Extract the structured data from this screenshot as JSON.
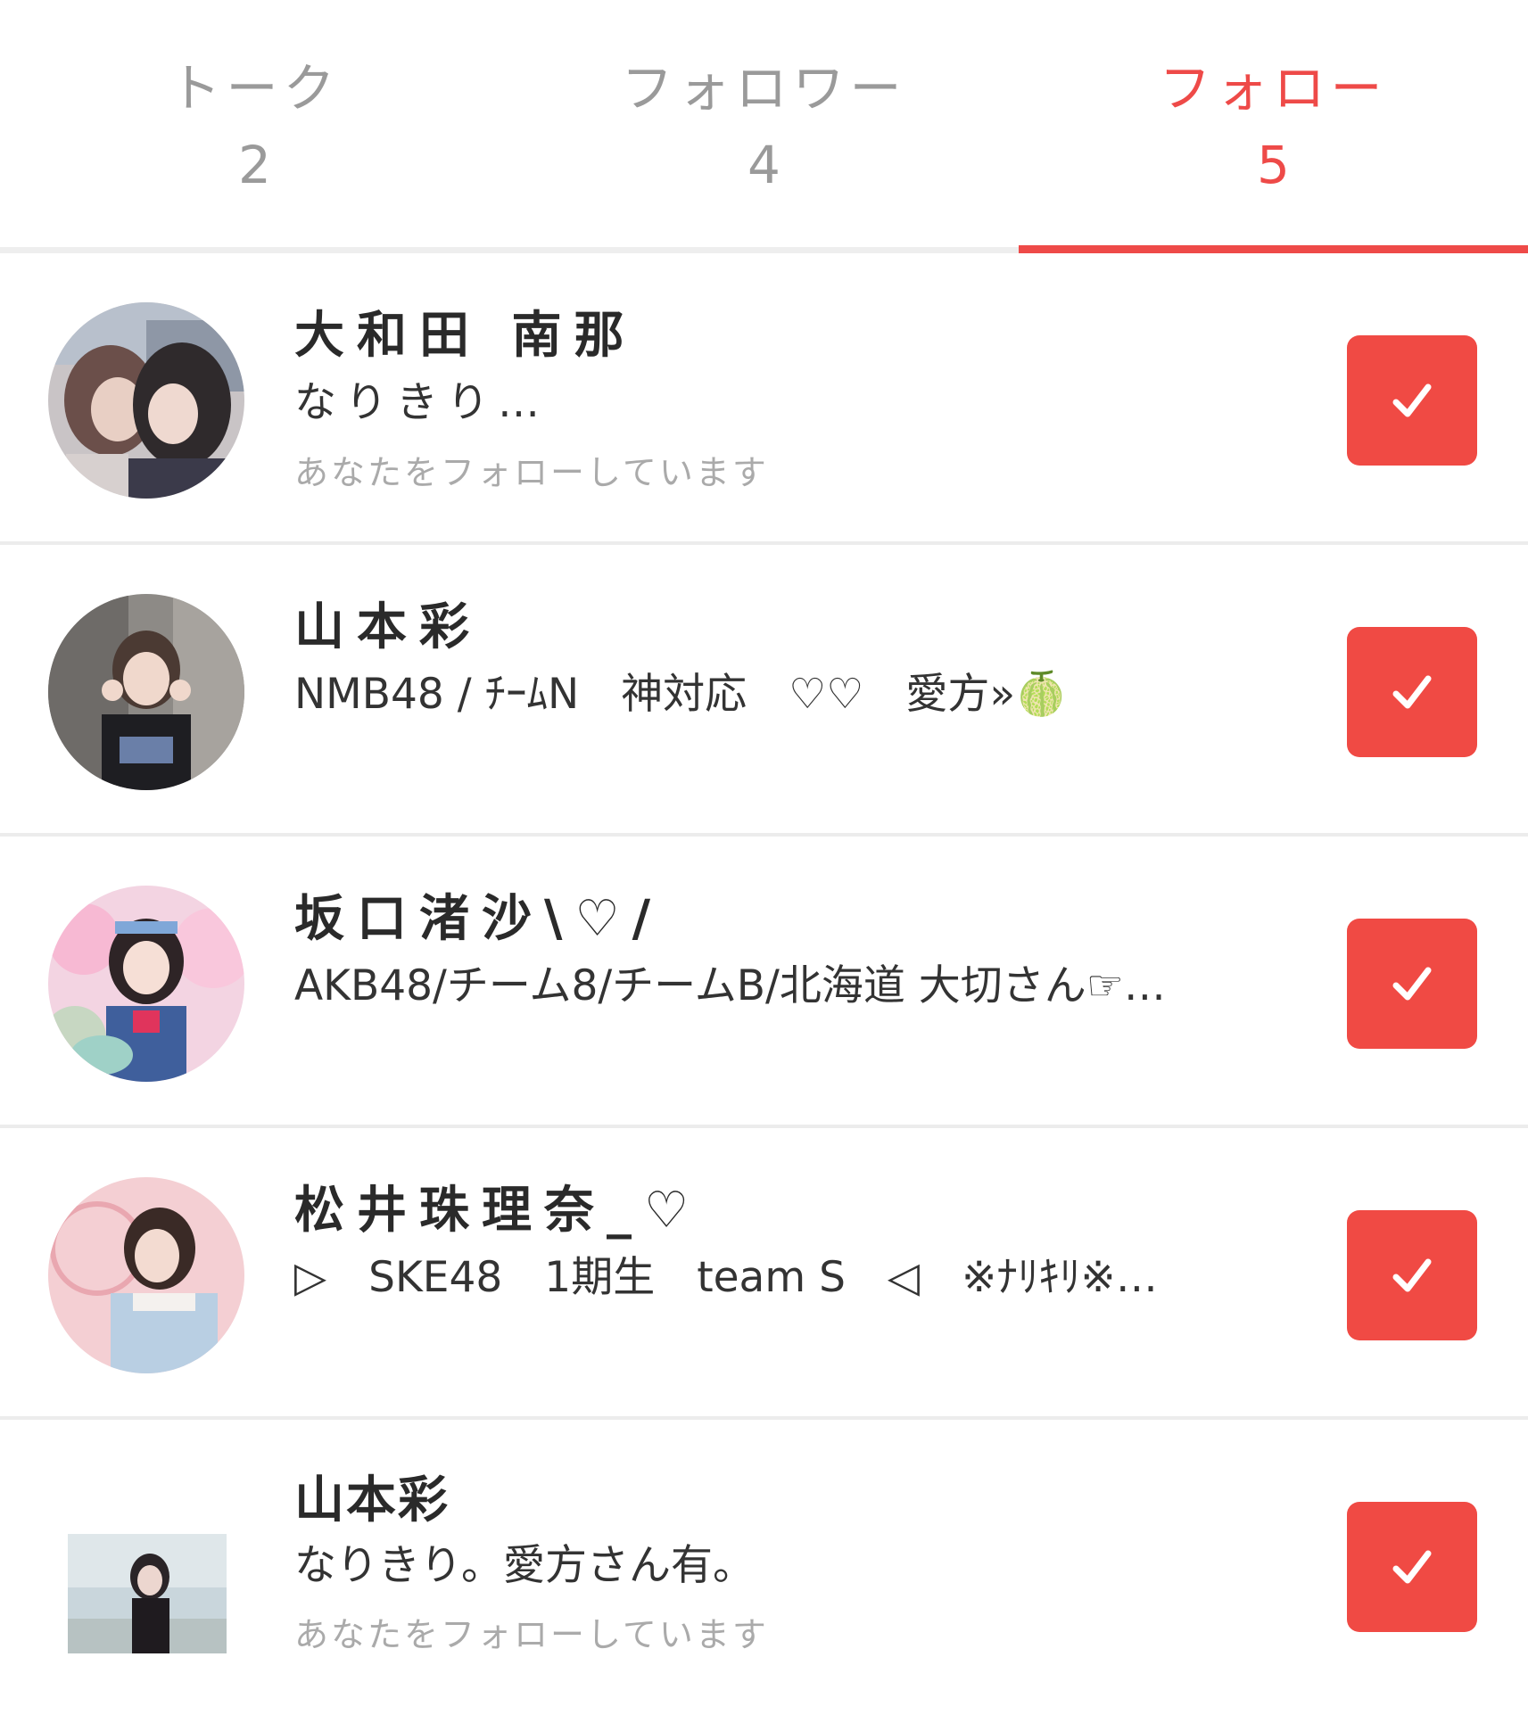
{
  "tabs": [
    {
      "label": "トーク",
      "count": "2",
      "active": false
    },
    {
      "label": "フォロワー",
      "count": "4",
      "active": false
    },
    {
      "label": "フォロー",
      "count": "5",
      "active": true
    }
  ],
  "colors": {
    "accent": "#ee4a48",
    "inactive_tab": "#9a9a9a",
    "button": "#f04a44"
  },
  "users": [
    {
      "name": "大和田 南那",
      "bio": "なりきり…",
      "follows_you": "あなたをフォローしています",
      "button_icon": "checkmark-icon"
    },
    {
      "name": "山本彩",
      "bio": "NMB48 / ﾁｰﾑN　神対応　♡♡　愛方»🍈",
      "button_icon": "checkmark-icon"
    },
    {
      "name": "坂口渚沙\\♡/",
      "bio": "AKB48/チーム8/チームB/北海道 大切さん☞…",
      "button_icon": "checkmark-icon"
    },
    {
      "name": "松井珠理奈_♡",
      "bio": "▷　SKE48　1期生　team S　◁　※ﾅﾘｷﾘ※…",
      "button_icon": "checkmark-icon"
    },
    {
      "name": "山本彩",
      "bio": "なりきり。愛方さん有。",
      "follows_you": "あなたをフォローしています",
      "button_icon": "checkmark-icon"
    }
  ]
}
